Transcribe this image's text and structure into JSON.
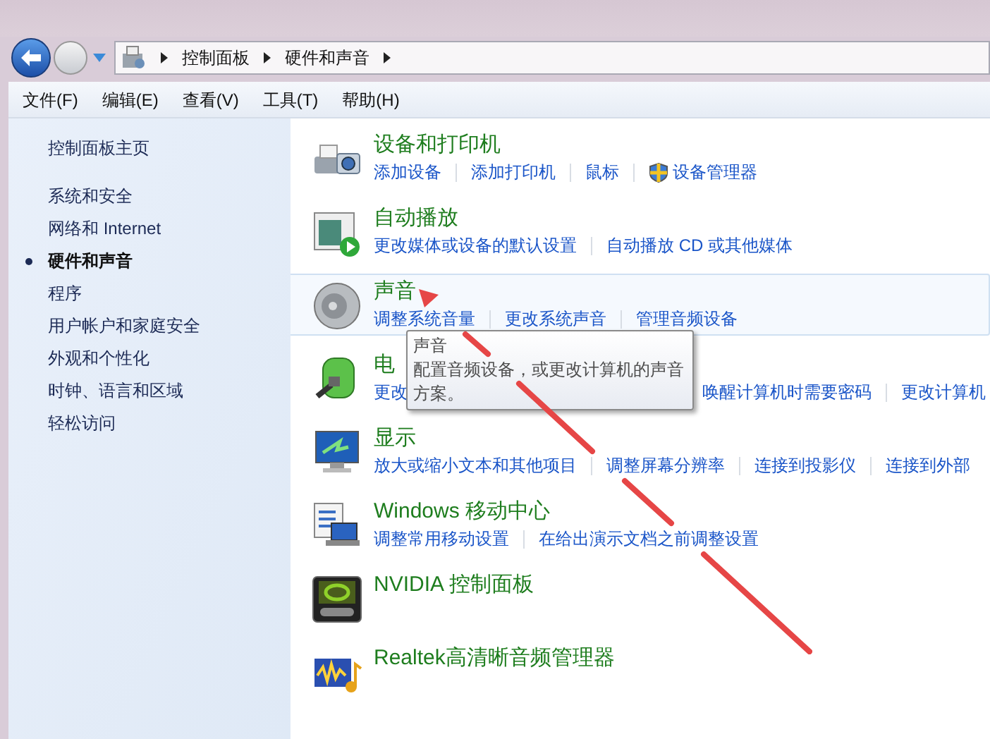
{
  "navigation": {
    "breadcrumb": [
      "控制面板",
      "硬件和声音"
    ]
  },
  "menu": [
    "文件(F)",
    "编辑(E)",
    "查看(V)",
    "工具(T)",
    "帮助(H)"
  ],
  "sidebar": {
    "items": [
      {
        "label": "控制面板主页",
        "selected": false
      },
      {
        "label": "系统和安全",
        "selected": false
      },
      {
        "label": "网络和 Internet",
        "selected": false
      },
      {
        "label": "硬件和声音",
        "selected": true
      },
      {
        "label": "程序",
        "selected": false
      },
      {
        "label": "用户帐户和家庭安全",
        "selected": false
      },
      {
        "label": "外观和个性化",
        "selected": false
      },
      {
        "label": "时钟、语言和区域",
        "selected": false
      },
      {
        "label": "轻松访问",
        "selected": false
      }
    ]
  },
  "categories": [
    {
      "kind": "printer",
      "title": "设备和打印机",
      "hovered": false,
      "links": [
        {
          "label": "添加设备",
          "admin": false
        },
        {
          "label": "添加打印机",
          "admin": false
        },
        {
          "label": "鼠标",
          "admin": false
        },
        {
          "label": "设备管理器",
          "admin": true
        }
      ]
    },
    {
      "kind": "autoplay",
      "title": "自动播放",
      "hovered": false,
      "links": [
        {
          "label": "更改媒体或设备的默认设置",
          "admin": false
        },
        {
          "label": "自动播放 CD 或其他媒体",
          "admin": false
        }
      ]
    },
    {
      "kind": "speaker",
      "title": "声音",
      "hovered": true,
      "links": [
        {
          "label": "调整系统音量",
          "admin": false
        },
        {
          "label": "更改系统声音",
          "admin": false
        },
        {
          "label": "管理音频设备",
          "admin": false
        }
      ]
    },
    {
      "kind": "battery",
      "title": "电",
      "hovered": false,
      "links": [
        {
          "label": "更改",
          "admin": false
        },
        {
          "label": "唤醒计算机时需要密码",
          "admin": false
        },
        {
          "label": "更改计算机",
          "admin": false
        }
      ]
    },
    {
      "kind": "monitor",
      "title": "显示",
      "hovered": false,
      "links": [
        {
          "label": "放大或缩小文本和其他项目",
          "admin": false
        },
        {
          "label": "调整屏幕分辨率",
          "admin": false
        },
        {
          "label": "连接到投影仪",
          "admin": false
        },
        {
          "label": "连接到外部",
          "admin": false
        }
      ]
    },
    {
      "kind": "mobility",
      "title": "Windows 移动中心",
      "hovered": false,
      "links": [
        {
          "label": "调整常用移动设置",
          "admin": false
        },
        {
          "label": "在给出演示文档之前调整设置",
          "admin": false
        }
      ]
    },
    {
      "kind": "nvidia",
      "title": "NVIDIA 控制面板",
      "hovered": false
    },
    {
      "kind": "realtek",
      "title": "Realtek高清晰音频管理器",
      "hovered": false
    }
  ],
  "tooltip": {
    "title": "声音",
    "text": "配置音频设备，或更改计算机的声音方案。"
  }
}
